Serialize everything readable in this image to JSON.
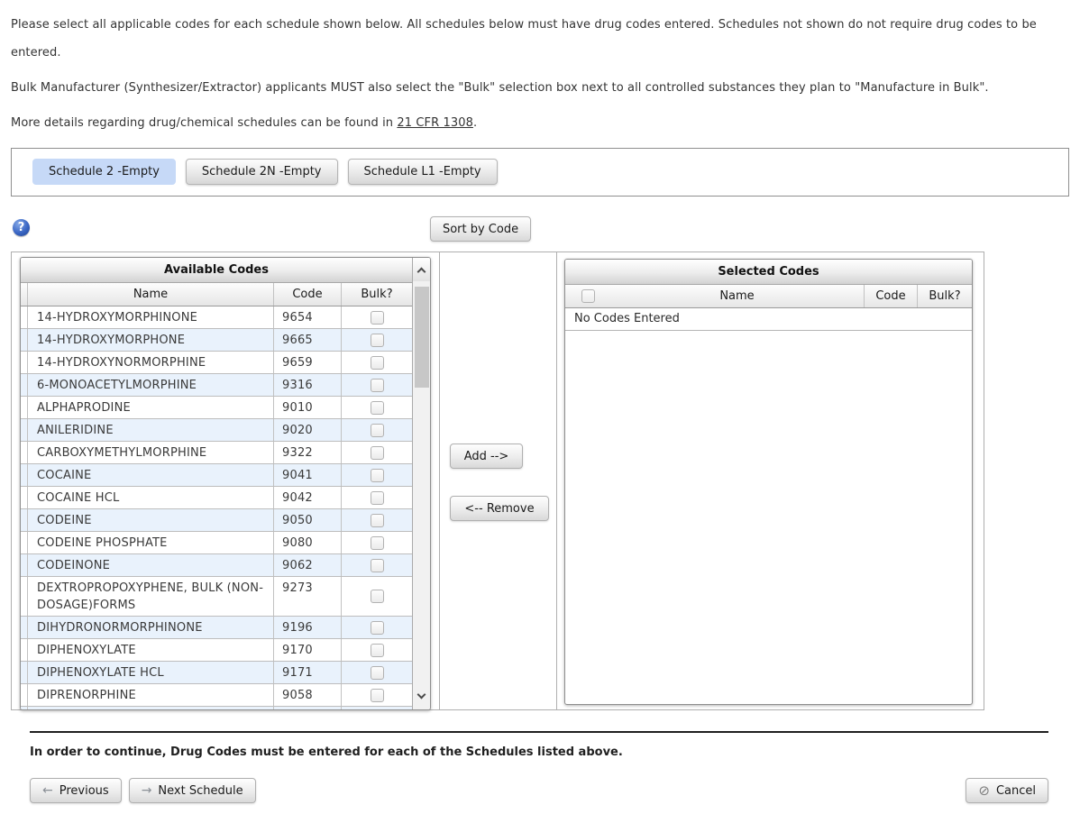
{
  "intro": {
    "p1": "Please select all applicable codes for each schedule shown below. All schedules below must have drug codes entered. Schedules not shown do not require drug codes to be entered.",
    "p2": "Bulk Manufacturer (Synthesizer/Extractor) applicants MUST also select the \"Bulk\" selection box next to all controlled substances they plan to \"Manufacture in Bulk\".",
    "p3_prefix": "More details regarding drug/chemical schedules can be found in ",
    "p3_link": "21 CFR 1308",
    "p3_suffix": "."
  },
  "tabs": [
    {
      "label": "Schedule 2 -Empty",
      "selected": true
    },
    {
      "label": "Schedule 2N -Empty",
      "selected": false
    },
    {
      "label": "Schedule L1 -Empty",
      "selected": false
    }
  ],
  "toolbar": {
    "sort_button": "Sort by Code"
  },
  "icons": {
    "help": "?",
    "previous_arrow": "←",
    "next_arrow": "→",
    "cancel": "⊘"
  },
  "available": {
    "title": "Available Codes",
    "columns": {
      "name": "Name",
      "code": "Code",
      "bulk": "Bulk?"
    },
    "rows": [
      {
        "name": "14-HYDROXYMORPHINONE",
        "code": "9654",
        "bulk_checked": false
      },
      {
        "name": "14-HYDROXYMORPHONE",
        "code": "9665",
        "bulk_checked": false
      },
      {
        "name": "14-HYDROXYNORMORPHINE",
        "code": "9659",
        "bulk_checked": false
      },
      {
        "name": "6-MONOACETYLMORPHINE",
        "code": "9316",
        "bulk_checked": false
      },
      {
        "name": "ALPHAPRODINE",
        "code": "9010",
        "bulk_checked": false
      },
      {
        "name": "ANILERIDINE",
        "code": "9020",
        "bulk_checked": false
      },
      {
        "name": "CARBOXYMETHYLMORPHINE",
        "code": "9322",
        "bulk_checked": false
      },
      {
        "name": "COCAINE",
        "code": "9041",
        "bulk_checked": false
      },
      {
        "name": "COCAINE HCL",
        "code": "9042",
        "bulk_checked": false
      },
      {
        "name": "CODEINE",
        "code": "9050",
        "bulk_checked": false
      },
      {
        "name": "CODEINE PHOSPHATE",
        "code": "9080",
        "bulk_checked": false
      },
      {
        "name": "CODEINONE",
        "code": "9062",
        "bulk_checked": false
      },
      {
        "name": "DEXTROPROPOXYPHENE, BULK (NON-DOSAGE)FORMS",
        "code": "9273",
        "bulk_checked": false
      },
      {
        "name": "DIHYDRONORMORPHINONE",
        "code": "9196",
        "bulk_checked": false
      },
      {
        "name": "DIPHENOXYLATE",
        "code": "9170",
        "bulk_checked": false
      },
      {
        "name": "DIPHENOXYLATE HCL",
        "code": "9171",
        "bulk_checked": false
      },
      {
        "name": "DIPRENORPHINE",
        "code": "9058",
        "bulk_checked": false
      }
    ]
  },
  "transfer": {
    "add_label": "Add -->",
    "remove_label": "<-- Remove"
  },
  "selected": {
    "title": "Selected Codes",
    "columns": {
      "name": "Name",
      "code": "Code",
      "bulk": "Bulk?"
    },
    "empty_message": "No Codes Entered",
    "rows": []
  },
  "footer": {
    "notice": "In order to continue, Drug Codes must be entered for each of the Schedules listed above.",
    "previous": "Previous",
    "next": "Next Schedule",
    "cancel": "Cancel"
  },
  "colors": {
    "selected_tab": "#c6d9f7",
    "alt_row": "#e9f2fc",
    "help_icon_blue": "#3a66c4"
  }
}
